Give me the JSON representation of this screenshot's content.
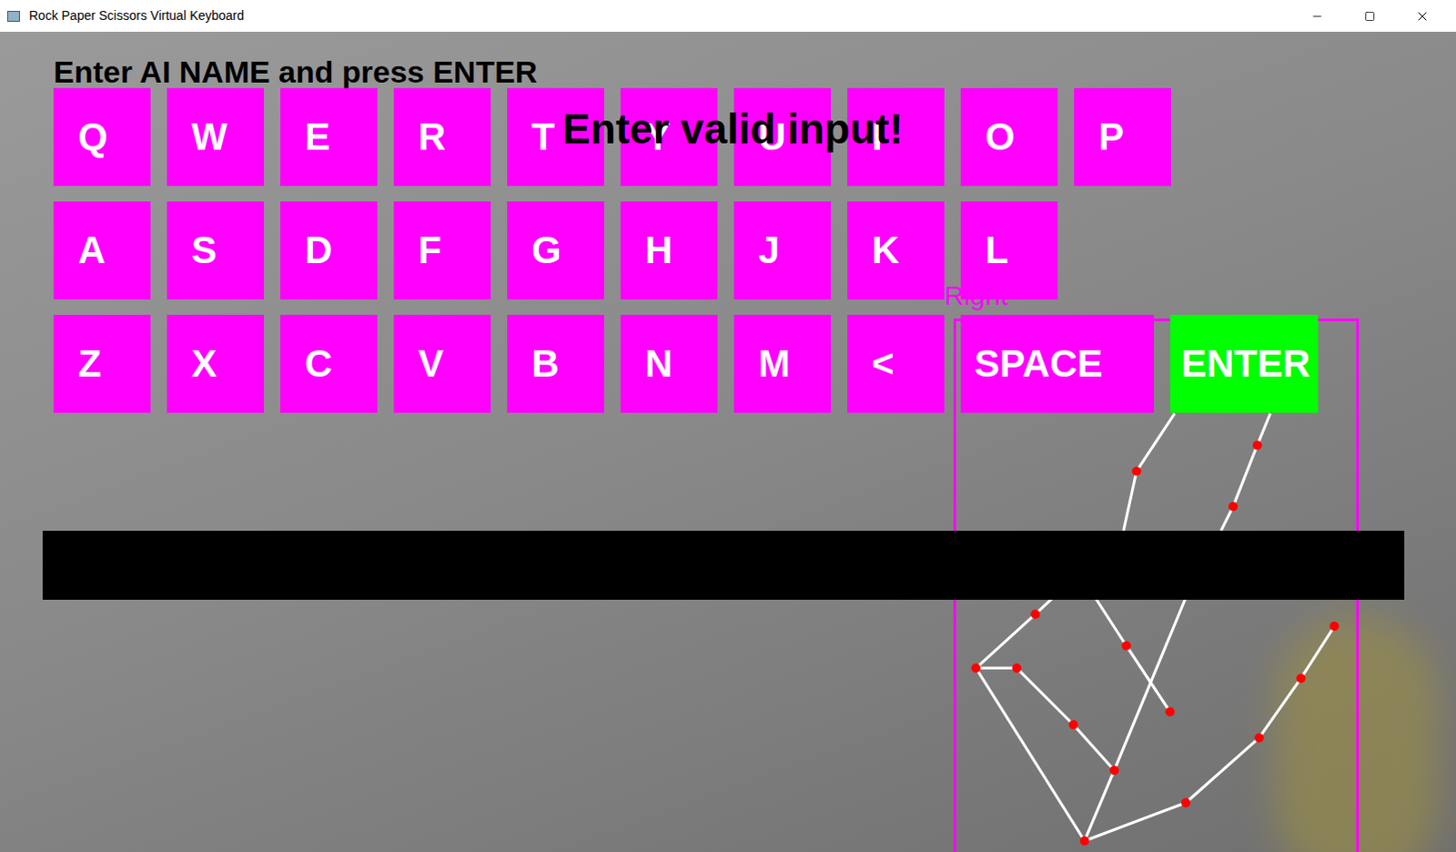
{
  "window": {
    "title": "Rock Paper Scissors Virtual Keyboard"
  },
  "prompt": "Enter AI NAME and press ENTER",
  "error": "Enter valid input!",
  "hand": {
    "label": "Right"
  },
  "keyboard": {
    "rows": [
      [
        {
          "label": "Q",
          "kind": "letter",
          "highlighted": false
        },
        {
          "label": "W",
          "kind": "letter",
          "highlighted": false
        },
        {
          "label": "E",
          "kind": "letter",
          "highlighted": false
        },
        {
          "label": "R",
          "kind": "letter",
          "highlighted": false
        },
        {
          "label": "T",
          "kind": "letter",
          "highlighted": false
        },
        {
          "label": "Y",
          "kind": "letter",
          "highlighted": false
        },
        {
          "label": "U",
          "kind": "letter",
          "highlighted": false
        },
        {
          "label": "I",
          "kind": "letter",
          "highlighted": false
        },
        {
          "label": "O",
          "kind": "letter",
          "highlighted": false
        },
        {
          "label": "P",
          "kind": "letter",
          "highlighted": false
        }
      ],
      [
        {
          "label": "A",
          "kind": "letter",
          "highlighted": false
        },
        {
          "label": "S",
          "kind": "letter",
          "highlighted": false
        },
        {
          "label": "D",
          "kind": "letter",
          "highlighted": false
        },
        {
          "label": "F",
          "kind": "letter",
          "highlighted": false
        },
        {
          "label": "G",
          "kind": "letter",
          "highlighted": false
        },
        {
          "label": "H",
          "kind": "letter",
          "highlighted": false
        },
        {
          "label": "J",
          "kind": "letter",
          "highlighted": false
        },
        {
          "label": "K",
          "kind": "letter",
          "highlighted": false
        },
        {
          "label": "L",
          "kind": "letter",
          "highlighted": false
        }
      ],
      [
        {
          "label": "Z",
          "kind": "letter",
          "highlighted": false
        },
        {
          "label": "X",
          "kind": "letter",
          "highlighted": false
        },
        {
          "label": "C",
          "kind": "letter",
          "highlighted": false
        },
        {
          "label": "V",
          "kind": "letter",
          "highlighted": false
        },
        {
          "label": "B",
          "kind": "letter",
          "highlighted": false
        },
        {
          "label": "N",
          "kind": "letter",
          "highlighted": false
        },
        {
          "label": "M",
          "kind": "letter",
          "highlighted": false
        },
        {
          "label": "<",
          "kind": "letter",
          "highlighted": false
        },
        {
          "label": "SPACE",
          "kind": "space",
          "highlighted": false
        },
        {
          "label": "ENTER",
          "kind": "enter",
          "highlighted": true
        }
      ]
    ]
  },
  "input": {
    "value": ""
  }
}
